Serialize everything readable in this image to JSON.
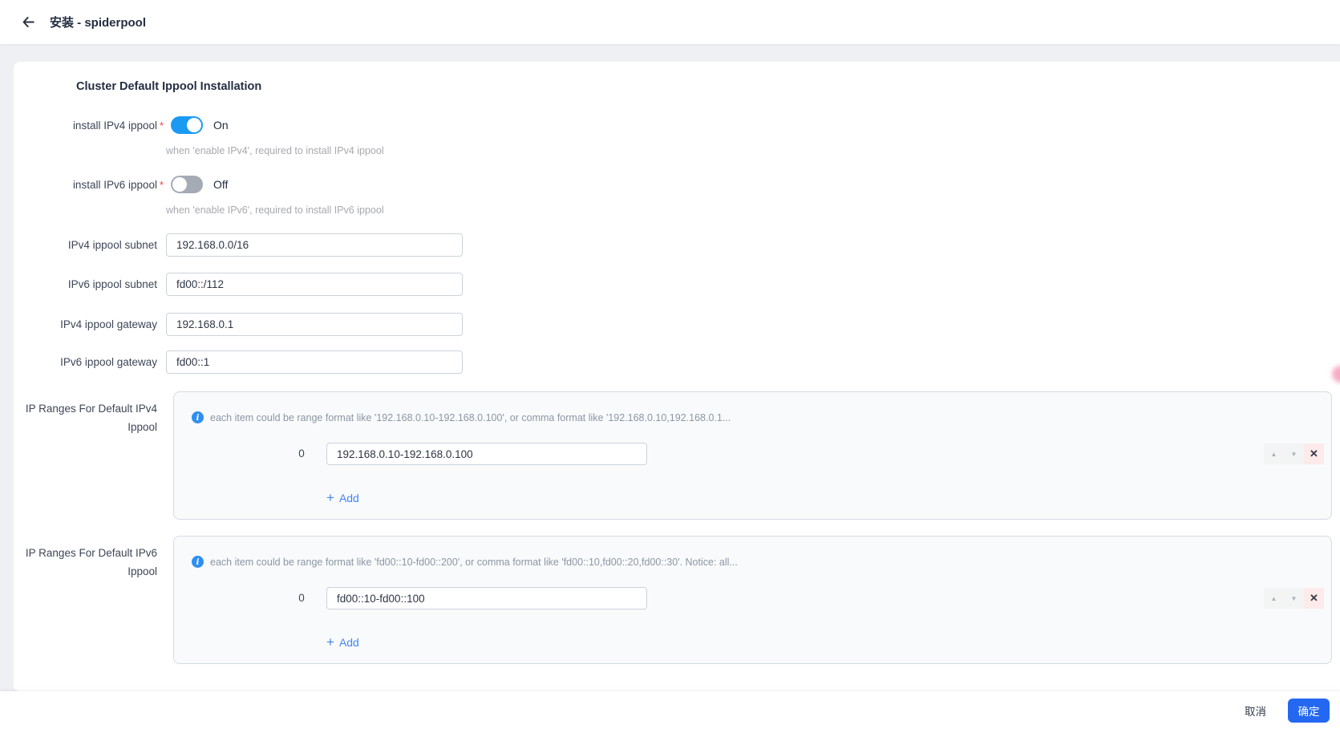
{
  "header": {
    "title": "安装 - spiderpool",
    "back_icon": "arrow-left"
  },
  "form": {
    "section_title": "Cluster Default Ippool Installation",
    "required_marker": "*",
    "toggles": [
      {
        "label": "install IPv4 ippool",
        "state": "On",
        "help": "when 'enable IPv4', required to install IPv4 ippool"
      },
      {
        "label": "install IPv6 ippool",
        "state": "Off",
        "help": "when 'enable IPv6', required to install IPv6 ippool"
      }
    ],
    "fields": [
      {
        "label": "IPv4 ippool subnet",
        "value": "192.168.0.0/16"
      },
      {
        "label": "IPv6 ippool subnet",
        "value": "fd00::/112"
      },
      {
        "label": "IPv4 ippool gateway",
        "value": "192.168.0.1"
      },
      {
        "label": "IPv6 ippool gateway",
        "value": "fd00::1"
      }
    ],
    "range_sections": [
      {
        "label_line1": "IP Ranges For Default IPv4",
        "label_line2": "Ippool",
        "hint": "each item could be range format like '192.168.0.10-192.168.0.100', or comma format like '192.168.0.10,192.168.0.1...",
        "item": {
          "index": "0",
          "value": "192.168.0.10-192.168.0.100"
        },
        "add_label": "Add"
      },
      {
        "label_line1": "IP Ranges For Default IPv6",
        "label_line2": "Ippool",
        "hint": "each item could be range format like 'fd00::10-fd00::200', or comma format like 'fd00::10,fd00::20,fd00::30'. Notice: all...",
        "item": {
          "index": "0",
          "value": "fd00::10-fd00::100"
        },
        "add_label": "Add"
      }
    ]
  },
  "icons": {
    "info": "i",
    "plus": "+",
    "move_up": "▲",
    "move_down": "▼",
    "close": "✕"
  },
  "footer": {
    "cancel_label": "取消",
    "ok_label": "确定"
  },
  "colors": {
    "primary": "#2468f2",
    "toggle_on": "#1a9af2",
    "info_icon": "#2e8ef2",
    "add_link": "#4285f4",
    "required": "#ea4641",
    "remove_bg": "#fdeaea",
    "page_bg": "#eef0f4"
  }
}
